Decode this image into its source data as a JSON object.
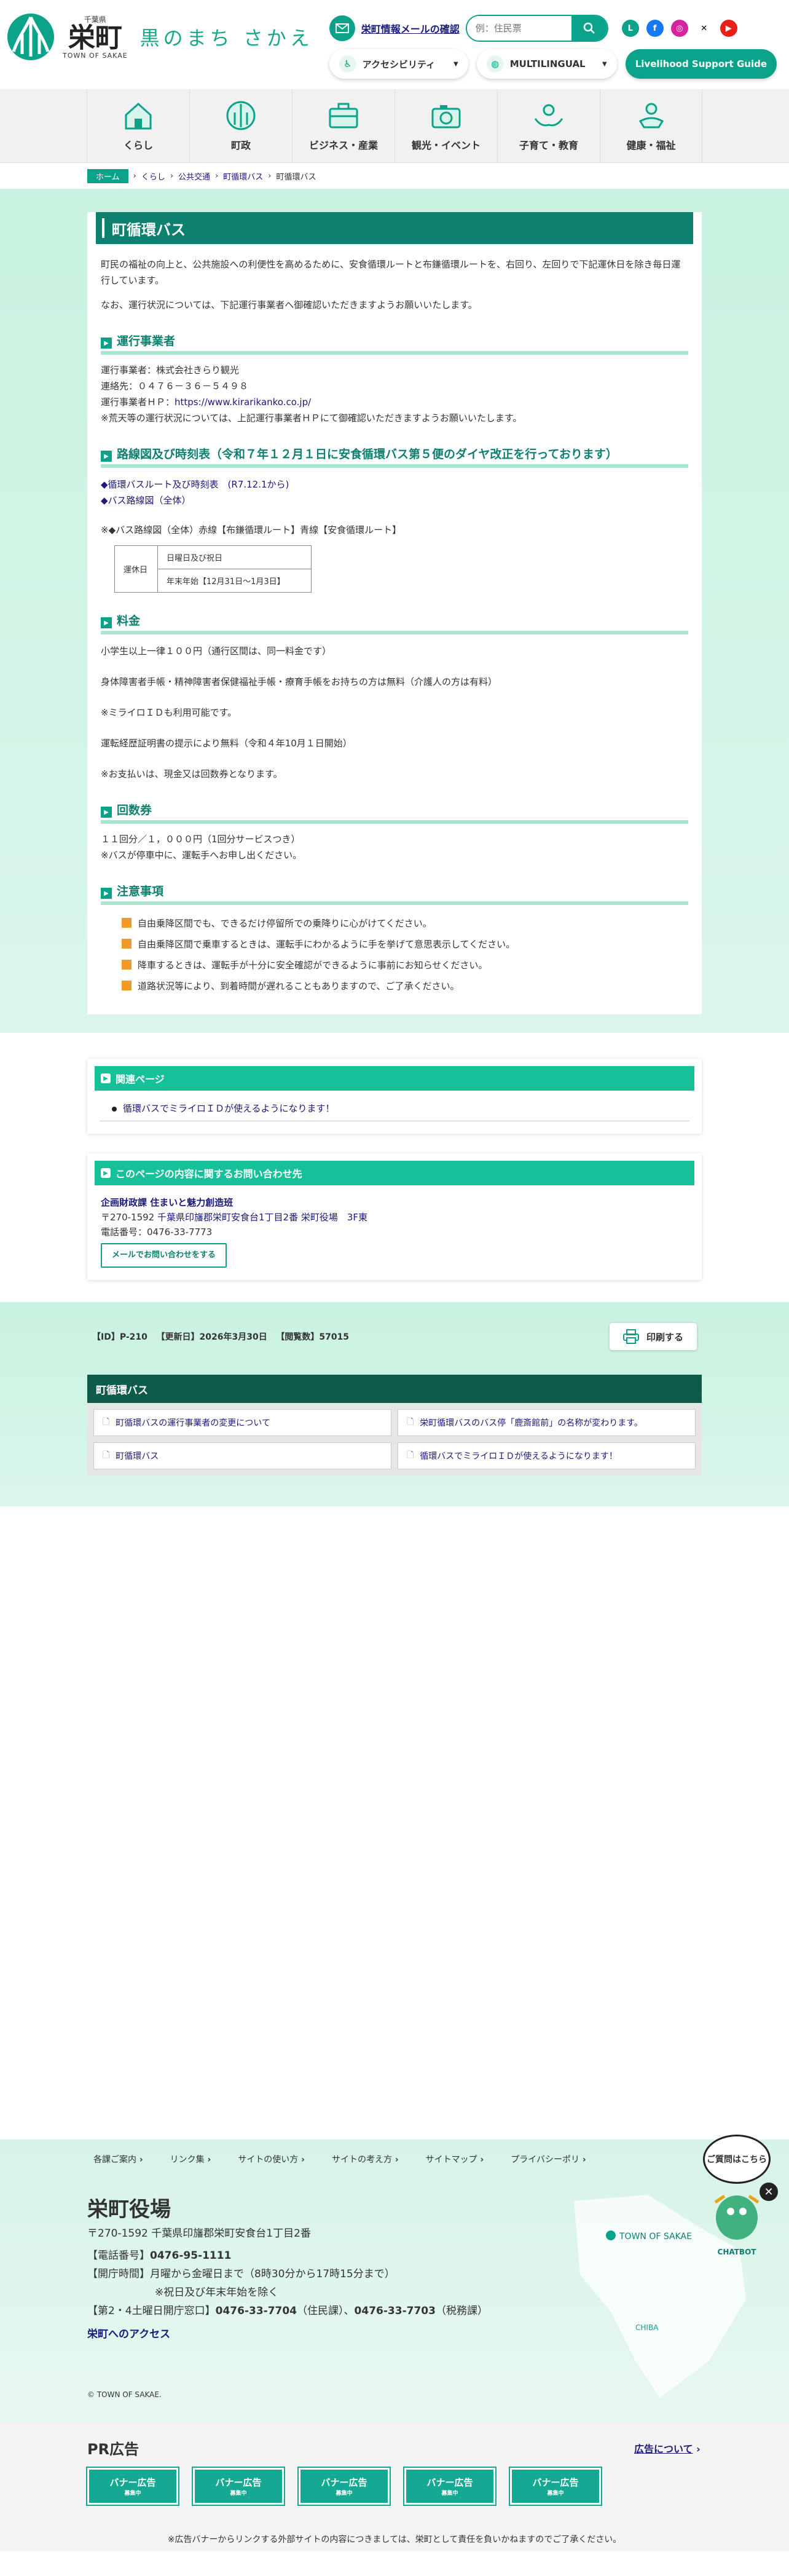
{
  "header": {
    "logo": {
      "pref": "千葉県",
      "name": "栄町",
      "en": "TOWN OF SAKAE",
      "catch": "黒のまち さかえ"
    },
    "mail_label": "栄町情報メールの確認",
    "search_placeholder": "例：住民票",
    "sns": [
      "LINE",
      "facebook",
      "instagram",
      "X",
      "YouTube"
    ],
    "accessibility": "アクセシビリティ",
    "multilingual": "MULTILINGUAL",
    "support_guide": "Livelihood Support Guide"
  },
  "nav": [
    {
      "label": "くらし",
      "icon": "house-icon"
    },
    {
      "label": "町政",
      "icon": "town-emblem-icon"
    },
    {
      "label": "ビジネス・産業",
      "icon": "briefcase-icon"
    },
    {
      "label": "観光・イベント",
      "icon": "camera-icon"
    },
    {
      "label": "子育て・教育",
      "icon": "hands-icon"
    },
    {
      "label": "健康・福祉",
      "icon": "care-icon"
    }
  ],
  "breadcrumb": [
    "ホーム",
    "くらし",
    "公共交通",
    "町循環バス",
    "町循環バス"
  ],
  "main": {
    "title": "町循環バス",
    "intro1": "町民の福祉の向上と、公共施設への利便性を高めるために、安食循環ルートと布鎌循環ルートを、右回り、左回りで下記運休日を除き毎日運行しています。",
    "intro2": "なお、運行状況については、下記運行事業者へ御確認いただきますようお願いいたします。",
    "sec1": {
      "heading": "運行事業者",
      "lines": [
        "運行事業者：株式会社きらり観光",
        "連絡先：０４７６－３６－５４９８"
      ],
      "hp_label": "運行事業者ＨＰ：",
      "hp_url": "https://www.kirarikanko.co.jp/",
      "note": "※荒天等の運行状況については、上記運行事業者ＨＰにて御確認いただきますようお願いいたします。"
    },
    "sec2": {
      "heading": "路線図及び時刻表（令和７年１２月１日に安食循環バス第５便のダイヤ改正を行っております）",
      "link1": "◆循環バスルート及び時刻表　(R7.12.1から)",
      "link2": "◆バス路線図（全体）",
      "note": "※◆バス路線図（全体）赤線【布鎌循環ルート】青線【安食循環ルート】",
      "table_head": "運休日",
      "table_rows": [
        "日曜日及び祝日",
        "年末年始【12月31日～1月3日】"
      ]
    },
    "sec3": {
      "heading": "料金",
      "lines": [
        "小学生以上一律１００円（通行区間は、同一料金です）",
        "身体障害者手帳・精神障害者保健福祉手帳・療育手帳をお持ちの方は無料（介護人の方は有料）",
        "※ミライロＩＤも利用可能です。",
        "運転経歴証明書の提示により無料（令和４年10月１日開始）",
        "※お支払いは、現金又は回数券となります。"
      ]
    },
    "sec4": {
      "heading": "回数券",
      "lines": [
        "１１回分／１，０００円（1回分サービスつき）",
        "※バスが停車中に、運転手へお申し出ください。"
      ]
    },
    "sec5": {
      "heading": "注意事項",
      "items": [
        "自由乗降区間でも、できるだけ停留所での乗降りに心がけてください。",
        "自由乗降区間で乗車するときは、運転手にわかるように手を挙げて意思表示してください。",
        "降車するときは、運転手が十分に安全確認ができるように事前にお知らせください。",
        "道路状況等により、到着時間が遅れることもありますので、ご了承ください。"
      ]
    }
  },
  "related": {
    "heading": "関連ページ",
    "link": "循環バスでミライロＩＤが使えるようになります！"
  },
  "contact": {
    "heading": "このページの内容に関するお問い合わせ先",
    "dept": "企画財政課 住まいと魅力創造班",
    "postal": "〒270-1592",
    "address": "千葉県印旛郡栄町安食台1丁目2番",
    "building": "栄町役場　3F東",
    "tel": "電話番号：0476-33-7773",
    "mail_btn": "メールでお問い合わせをする"
  },
  "meta": {
    "id": "【ID】P-210",
    "updated": "【更新日】2026年3月30日",
    "views": "【閲覧数】57015",
    "print": "印刷する"
  },
  "category_list": {
    "heading": "町循環バス",
    "items": [
      "町循環バスの運行事業者の変更について",
      "栄町循環バスのバス停「鹿斎館前」の名称が変わります。",
      "町循環バス",
      "循環バスでミライロＩＤが使えるようになります！"
    ]
  },
  "footer": {
    "links": [
      "各課ご案内",
      "リンク集",
      "サイトの使い方",
      "サイトの考え方",
      "サイトマップ",
      "プライバシーポリ"
    ],
    "name": "栄町役場",
    "address": "〒270-1592 千葉県印旛郡栄町安食台1丁目2番",
    "tel_label": "【電話番号】",
    "tel": "0476-95-1111",
    "hours": "【開庁時間】月曜から金曜日まで（8時30分から17時15分まで）",
    "hours2": "※祝日及び年末年始を除く",
    "sat_label": "【第2・4土曜日開庁窓口】",
    "sat_tel1": "0476-33-7704",
    "sat_note1": "（住民課）、",
    "sat_tel2": "0476-33-7703",
    "sat_note2": "（税務課）",
    "access": "栄町へのアクセス",
    "copyright": "© TOWN OF SAKAE.",
    "chat_bubble": "ご質問はこちら",
    "chatbot": "CHATBOT",
    "map_label": "TOWN OF SAKAE",
    "map_pref": "CHIBA"
  },
  "pr": {
    "heading": "PR広告",
    "about": "広告について",
    "banner": "バナー広告",
    "banner_sub": "募集中",
    "note": "※広告バナーからリンクする外部サイトの内容につきましては、栄町として責任を負いかねますのでご了承ください。"
  },
  "colors": {
    "accent": "#0aa38a",
    "title_bg": "#0d8070",
    "bg_mint": "#d3f3e5",
    "orange": "#f19a27"
  }
}
